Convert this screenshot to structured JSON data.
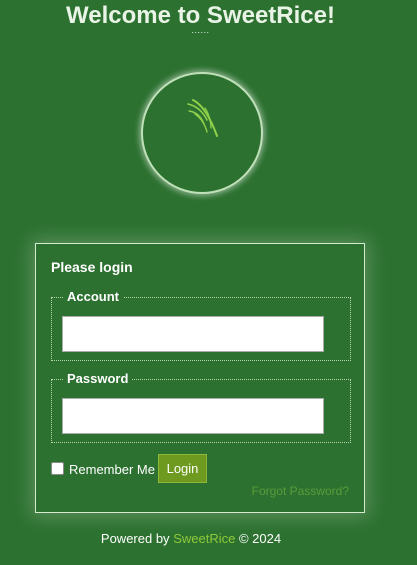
{
  "header": {
    "title": "Welcome to SweetRice!",
    "subtitle": "......"
  },
  "logo": {
    "icon": "grass-sprout-icon"
  },
  "login": {
    "heading": "Please login",
    "account_legend": "Account",
    "account_value": "",
    "password_legend": "Password",
    "password_value": "",
    "remember_label": "Remember Me",
    "remember_checked": false,
    "login_button": "Login",
    "forgot_link": "Forgot Password?"
  },
  "footer": {
    "prefix": "Powered by",
    "link_text": "SweetRice",
    "suffix": "© 2024"
  },
  "colors": {
    "background": "#2c7130",
    "button": "#6e9a1f",
    "link": "#8fc93a",
    "forgot_link": "#5a9b3a"
  }
}
